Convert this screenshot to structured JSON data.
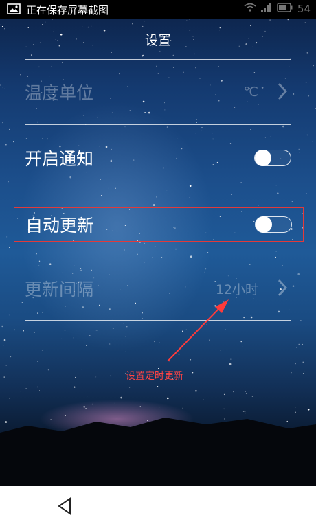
{
  "statusbar": {
    "notification_text": "正在保存屏幕截图",
    "battery": "54"
  },
  "header": {
    "title": "设置"
  },
  "settings": [
    {
      "label": "温度单位",
      "value": "℃",
      "type": "chevron",
      "enabled": false
    },
    {
      "label": "开启通知",
      "type": "toggle",
      "checked": false,
      "enabled": true
    },
    {
      "label": "自动更新",
      "type": "toggle",
      "checked": false,
      "enabled": true,
      "highlighted": true
    },
    {
      "label": "更新间隔",
      "value": "12小时",
      "type": "chevron",
      "enabled": false
    }
  ],
  "annotation": {
    "text": "设置定时更新",
    "color": "#ff4444"
  },
  "colors": {
    "highlight": "#e23a3a",
    "statusbar_bg": "#000000"
  },
  "navigation": {
    "back_icon": "back-triangle-icon"
  }
}
